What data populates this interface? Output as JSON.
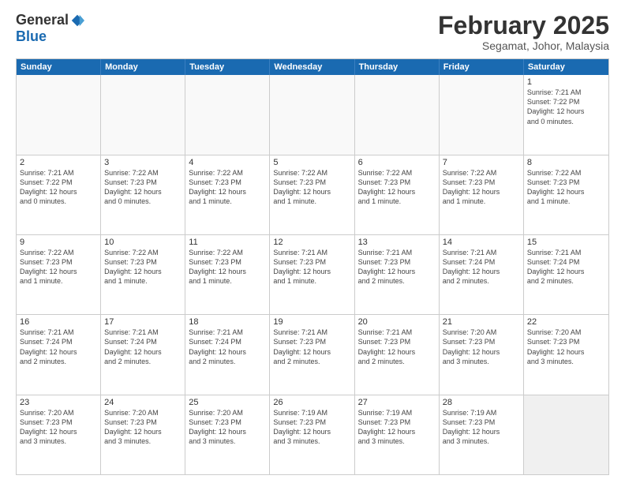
{
  "logo": {
    "general": "General",
    "blue": "Blue"
  },
  "header": {
    "month": "February 2025",
    "location": "Segamat, Johor, Malaysia"
  },
  "weekdays": [
    "Sunday",
    "Monday",
    "Tuesday",
    "Wednesday",
    "Thursday",
    "Friday",
    "Saturday"
  ],
  "rows": [
    [
      {
        "day": "",
        "info": "",
        "empty": true
      },
      {
        "day": "",
        "info": "",
        "empty": true
      },
      {
        "day": "",
        "info": "",
        "empty": true
      },
      {
        "day": "",
        "info": "",
        "empty": true
      },
      {
        "day": "",
        "info": "",
        "empty": true
      },
      {
        "day": "",
        "info": "",
        "empty": true
      },
      {
        "day": "1",
        "info": "Sunrise: 7:21 AM\nSunset: 7:22 PM\nDaylight: 12 hours\nand 0 minutes."
      }
    ],
    [
      {
        "day": "2",
        "info": "Sunrise: 7:21 AM\nSunset: 7:22 PM\nDaylight: 12 hours\nand 0 minutes."
      },
      {
        "day": "3",
        "info": "Sunrise: 7:22 AM\nSunset: 7:23 PM\nDaylight: 12 hours\nand 0 minutes."
      },
      {
        "day": "4",
        "info": "Sunrise: 7:22 AM\nSunset: 7:23 PM\nDaylight: 12 hours\nand 1 minute."
      },
      {
        "day": "5",
        "info": "Sunrise: 7:22 AM\nSunset: 7:23 PM\nDaylight: 12 hours\nand 1 minute."
      },
      {
        "day": "6",
        "info": "Sunrise: 7:22 AM\nSunset: 7:23 PM\nDaylight: 12 hours\nand 1 minute."
      },
      {
        "day": "7",
        "info": "Sunrise: 7:22 AM\nSunset: 7:23 PM\nDaylight: 12 hours\nand 1 minute."
      },
      {
        "day": "8",
        "info": "Sunrise: 7:22 AM\nSunset: 7:23 PM\nDaylight: 12 hours\nand 1 minute."
      }
    ],
    [
      {
        "day": "9",
        "info": "Sunrise: 7:22 AM\nSunset: 7:23 PM\nDaylight: 12 hours\nand 1 minute."
      },
      {
        "day": "10",
        "info": "Sunrise: 7:22 AM\nSunset: 7:23 PM\nDaylight: 12 hours\nand 1 minute."
      },
      {
        "day": "11",
        "info": "Sunrise: 7:22 AM\nSunset: 7:23 PM\nDaylight: 12 hours\nand 1 minute."
      },
      {
        "day": "12",
        "info": "Sunrise: 7:21 AM\nSunset: 7:23 PM\nDaylight: 12 hours\nand 1 minute."
      },
      {
        "day": "13",
        "info": "Sunrise: 7:21 AM\nSunset: 7:23 PM\nDaylight: 12 hours\nand 2 minutes."
      },
      {
        "day": "14",
        "info": "Sunrise: 7:21 AM\nSunset: 7:24 PM\nDaylight: 12 hours\nand 2 minutes."
      },
      {
        "day": "15",
        "info": "Sunrise: 7:21 AM\nSunset: 7:24 PM\nDaylight: 12 hours\nand 2 minutes."
      }
    ],
    [
      {
        "day": "16",
        "info": "Sunrise: 7:21 AM\nSunset: 7:24 PM\nDaylight: 12 hours\nand 2 minutes."
      },
      {
        "day": "17",
        "info": "Sunrise: 7:21 AM\nSunset: 7:24 PM\nDaylight: 12 hours\nand 2 minutes."
      },
      {
        "day": "18",
        "info": "Sunrise: 7:21 AM\nSunset: 7:24 PM\nDaylight: 12 hours\nand 2 minutes."
      },
      {
        "day": "19",
        "info": "Sunrise: 7:21 AM\nSunset: 7:23 PM\nDaylight: 12 hours\nand 2 minutes."
      },
      {
        "day": "20",
        "info": "Sunrise: 7:21 AM\nSunset: 7:23 PM\nDaylight: 12 hours\nand 2 minutes."
      },
      {
        "day": "21",
        "info": "Sunrise: 7:20 AM\nSunset: 7:23 PM\nDaylight: 12 hours\nand 3 minutes."
      },
      {
        "day": "22",
        "info": "Sunrise: 7:20 AM\nSunset: 7:23 PM\nDaylight: 12 hours\nand 3 minutes."
      }
    ],
    [
      {
        "day": "23",
        "info": "Sunrise: 7:20 AM\nSunset: 7:23 PM\nDaylight: 12 hours\nand 3 minutes."
      },
      {
        "day": "24",
        "info": "Sunrise: 7:20 AM\nSunset: 7:23 PM\nDaylight: 12 hours\nand 3 minutes."
      },
      {
        "day": "25",
        "info": "Sunrise: 7:20 AM\nSunset: 7:23 PM\nDaylight: 12 hours\nand 3 minutes."
      },
      {
        "day": "26",
        "info": "Sunrise: 7:19 AM\nSunset: 7:23 PM\nDaylight: 12 hours\nand 3 minutes."
      },
      {
        "day": "27",
        "info": "Sunrise: 7:19 AM\nSunset: 7:23 PM\nDaylight: 12 hours\nand 3 minutes."
      },
      {
        "day": "28",
        "info": "Sunrise: 7:19 AM\nSunset: 7:23 PM\nDaylight: 12 hours\nand 3 minutes."
      },
      {
        "day": "",
        "info": "",
        "empty": true,
        "shaded": true
      }
    ]
  ]
}
